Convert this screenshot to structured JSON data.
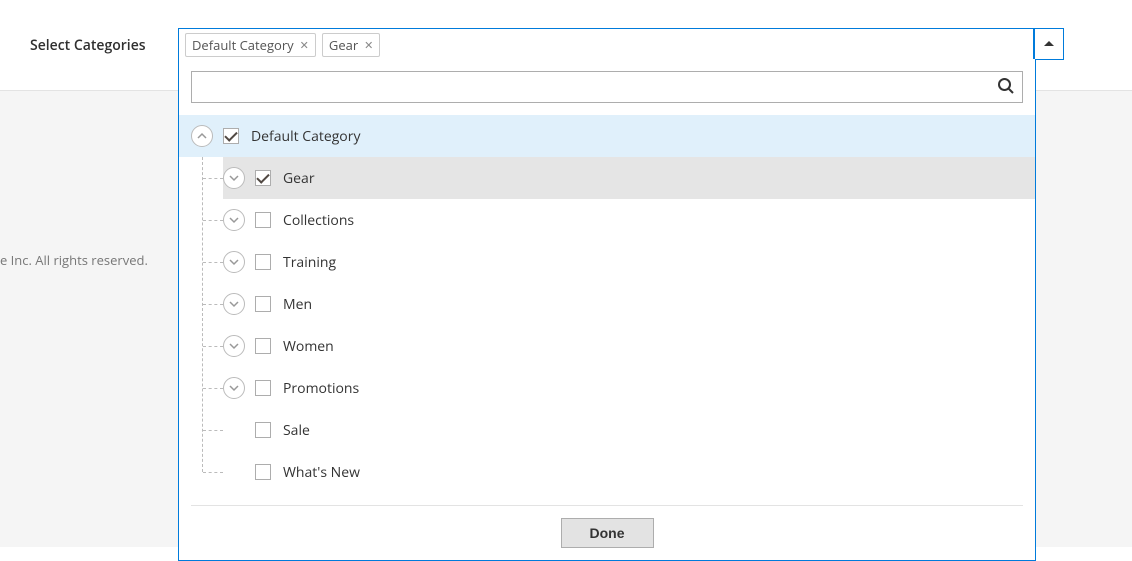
{
  "field_label": "Select Categories",
  "copyright_fragment": "e Inc. All rights reserved.",
  "chips": [
    {
      "label": "Default Category"
    },
    {
      "label": "Gear"
    }
  ],
  "search": {
    "value": "",
    "placeholder": ""
  },
  "tree": {
    "root": {
      "label": "Default Category",
      "checked": true,
      "expanded": true
    },
    "children": [
      {
        "label": "Gear",
        "checked": true,
        "has_children": true,
        "hovered": true
      },
      {
        "label": "Collections",
        "checked": false,
        "has_children": true
      },
      {
        "label": "Training",
        "checked": false,
        "has_children": true
      },
      {
        "label": "Men",
        "checked": false,
        "has_children": true
      },
      {
        "label": "Women",
        "checked": false,
        "has_children": true
      },
      {
        "label": "Promotions",
        "checked": false,
        "has_children": true
      },
      {
        "label": "Sale",
        "checked": false,
        "has_children": false
      },
      {
        "label": "What's New",
        "checked": false,
        "has_children": false
      }
    ]
  },
  "done_label": "Done"
}
